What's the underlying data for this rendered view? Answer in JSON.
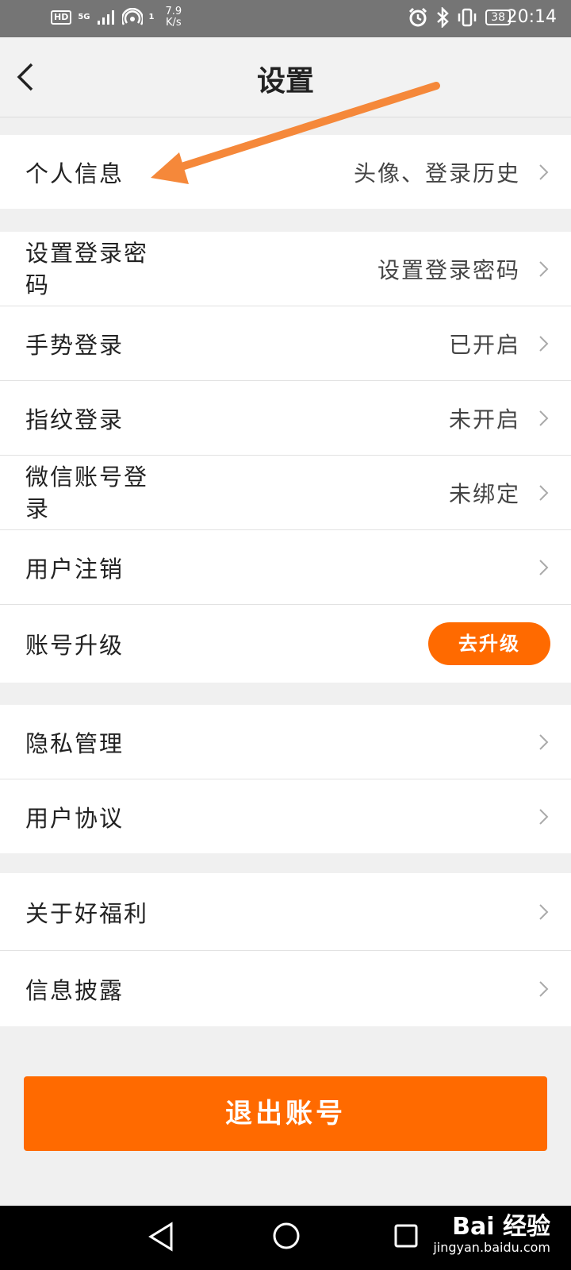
{
  "status_bar": {
    "hd": "HD",
    "network": "5G",
    "sim_index": "1",
    "speed_value": "7.9",
    "speed_unit": "K/s",
    "battery": "38",
    "time": "20:14",
    "icons": [
      "wifi-hotspot-icon",
      "alarm-icon",
      "bluetooth-icon",
      "vibrate-icon",
      "battery-icon"
    ]
  },
  "header": {
    "title": "设置",
    "back_icon": "chevron-left-icon"
  },
  "groups": {
    "personal": {
      "rows": [
        {
          "label": "个人信息",
          "value": "头像、登录历史"
        }
      ]
    },
    "account": {
      "rows": [
        {
          "label": "设置登录密码",
          "value": "设置登录密码"
        },
        {
          "label": "手势登录",
          "value": "已开启"
        },
        {
          "label": "指纹登录",
          "value": "未开启"
        },
        {
          "label": "微信账号登录",
          "value": "未绑定"
        },
        {
          "label": "用户注销",
          "value": ""
        },
        {
          "label": "账号升级",
          "button": "去升级"
        }
      ]
    },
    "privacy": {
      "rows": [
        {
          "label": "隐私管理"
        },
        {
          "label": "用户协议"
        }
      ]
    },
    "about": {
      "rows": [
        {
          "label": "关于好福利"
        },
        {
          "label": "信息披露"
        }
      ]
    }
  },
  "logout_label": "退出账号",
  "annotation": {
    "color": "#f5883a"
  },
  "colors": {
    "accent": "#ff6a00",
    "background": "#f0f0f0"
  },
  "nav_bar": {
    "icons": [
      "back-triangle-icon",
      "home-circle-icon",
      "recent-square-icon"
    ]
  },
  "watermark": {
    "brand": "Bai 经验",
    "url": "jingyan.baidu.com"
  }
}
